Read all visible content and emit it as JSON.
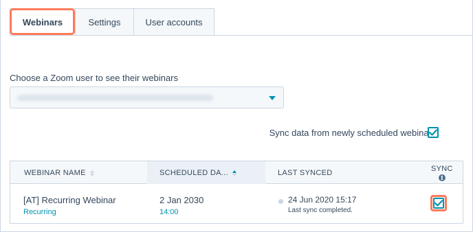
{
  "tabs": [
    {
      "label": "Webinars",
      "active": true
    },
    {
      "label": "Settings",
      "active": false
    },
    {
      "label": "User accounts",
      "active": false
    }
  ],
  "zoom_user": {
    "label": "Choose a Zoom user to see their webinars",
    "selected_value": ""
  },
  "sync_option": {
    "label": "Sync data from newly scheduled webinars.",
    "checked": true
  },
  "table": {
    "columns": [
      {
        "label": "WEBINAR NAME",
        "sortable": true,
        "sorted": false
      },
      {
        "label": "SCHEDULED DA...",
        "sortable": true,
        "sorted": "asc"
      },
      {
        "label": "LAST SYNCED",
        "sortable": false
      },
      {
        "label": "SYNC",
        "info_icon": "info-icon"
      }
    ],
    "rows": [
      {
        "name": "[AT] Recurring Webinar",
        "type": "Recurring",
        "date": "2 Jan 2030",
        "time": "14:00",
        "last_synced": "24 Jun 2020 15:17",
        "sync_status": "Last sync completed.",
        "sync": true
      }
    ]
  },
  "colors": {
    "accent": "#0091ae",
    "highlight": "#ff7a59",
    "text": "#33475b",
    "border": "#cbd6e2"
  }
}
